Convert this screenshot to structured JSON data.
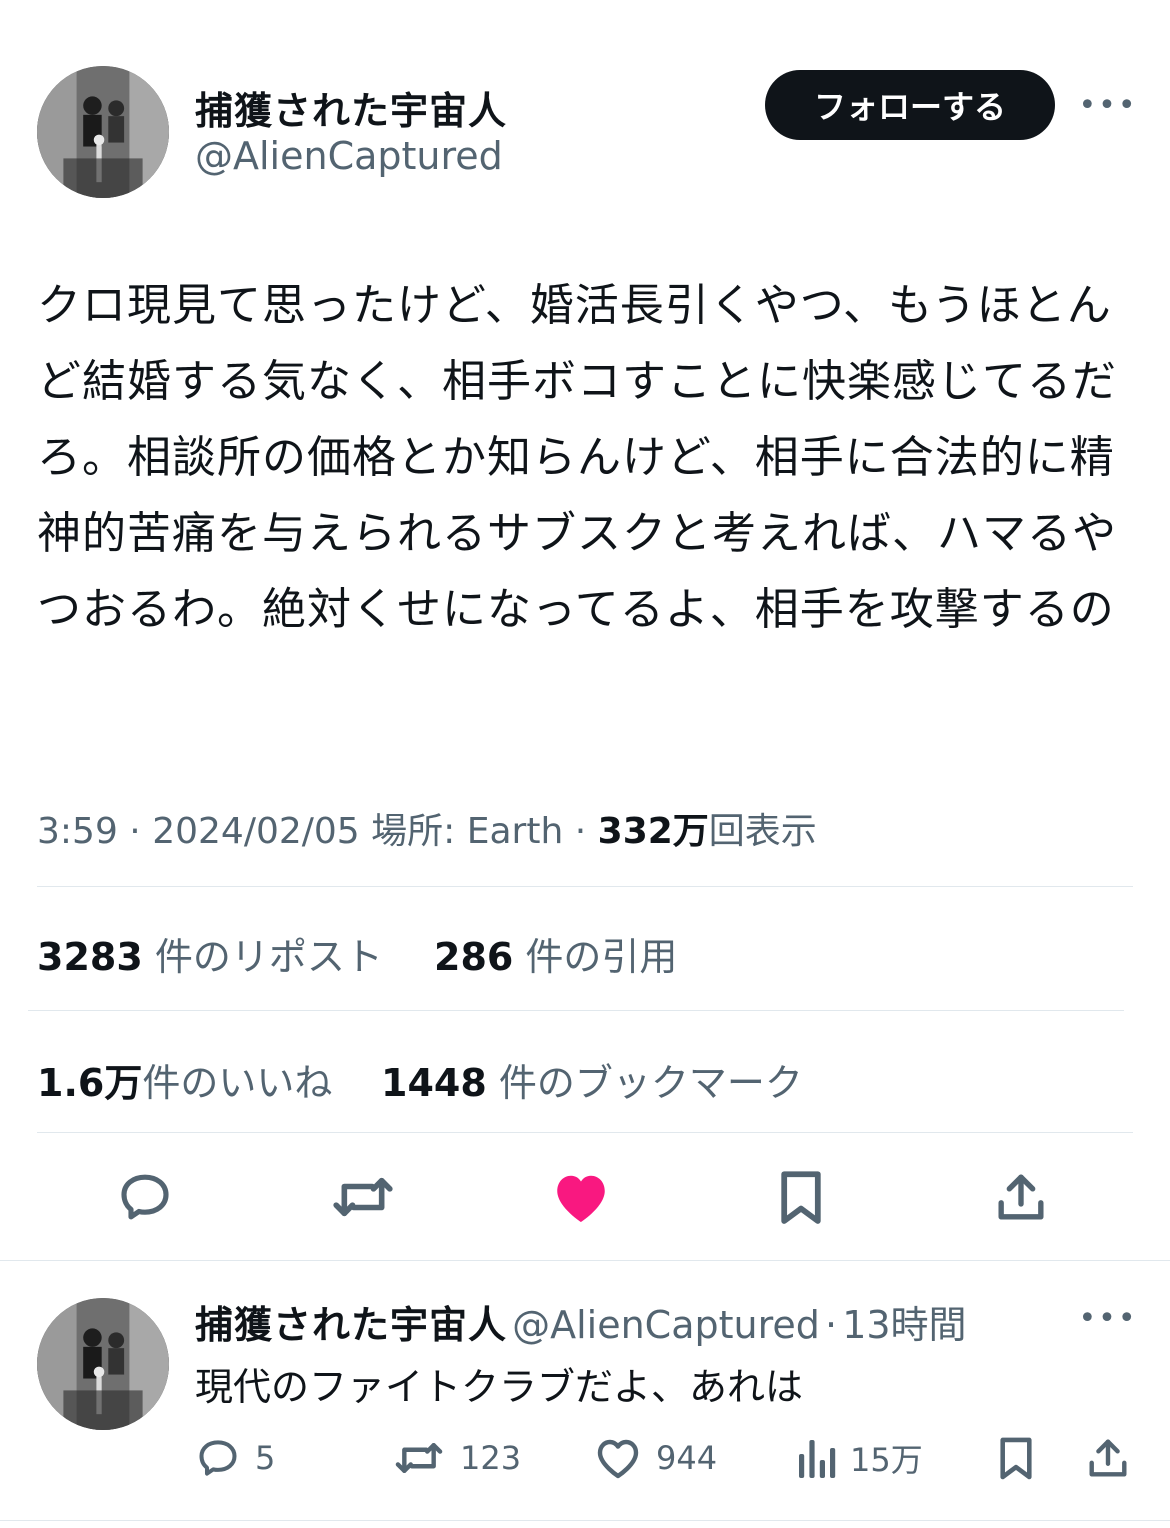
{
  "tweet": {
    "author_name": "捕獲された宇宙人",
    "author_handle": "@AlienCaptured",
    "follow_label": "フォローする",
    "more_label": "•••",
    "text": "クロ現見て思ったけど、婚活長引くやつ、もうほとんど結婚する気なく、相手ボコすことに快楽感じてるだろ。相談所の価格とか知らんけど、相手に合法的に精神的苦痛を与えられるサブスクと考えれば、ハマるやつおるわ。絶対くせになってるよ、相手を攻撃するの",
    "time": "3:59",
    "separator": "·",
    "date": "2024/02/05",
    "location": "場所: Earth",
    "views_count": "332万",
    "views_label": "回表示"
  },
  "stats": {
    "reposts_count": "3283",
    "reposts_label": "件のリポスト",
    "quotes_count": "286",
    "quotes_label": "件の引用",
    "likes_count": "1.6万",
    "likes_label": "件のいいね",
    "bookmarks_count": "1448",
    "bookmarks_label": "件のブックマーク"
  },
  "icons": {
    "reply": "reply-icon",
    "repost": "repost-icon",
    "like": "heart-icon",
    "bookmark": "bookmark-icon",
    "share": "share-icon",
    "views": "views-icon"
  },
  "colors": {
    "text": "#0f1419",
    "muted": "#536471",
    "like_active": "#f91880",
    "divider": "#e1e8ed",
    "button_bg": "#0f1419"
  },
  "reply": {
    "author_name": "捕獲された宇宙人",
    "author_handle": "@AlienCaptured",
    "separator": "·",
    "time_ago": "13時間",
    "more_label": "•••",
    "text": "現代のファイトクラブだよ、あれは",
    "reply_count": "5",
    "repost_count": "123",
    "like_count": "944",
    "views_count": "15万"
  }
}
